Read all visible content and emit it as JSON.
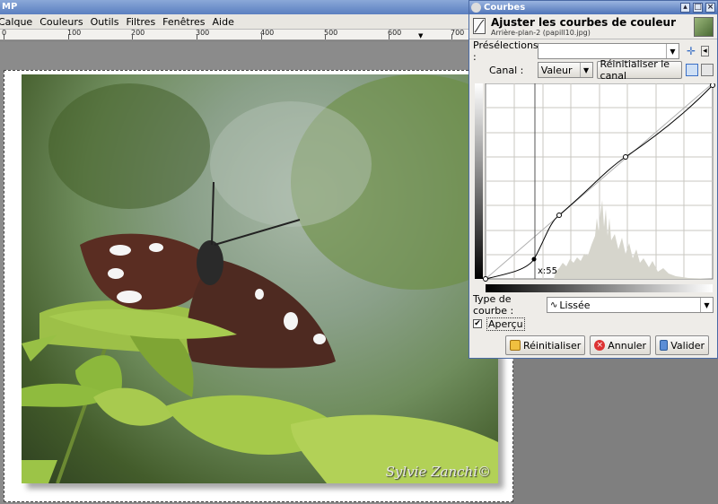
{
  "gimp": {
    "title": "MP",
    "menu": [
      "Calque",
      "Couleurs",
      "Outils",
      "Filtres",
      "Fenêtres",
      "Aide"
    ],
    "ruler_labels": [
      "0",
      "100",
      "200",
      "300",
      "400",
      "500",
      "600",
      "700"
    ],
    "signature": "Sylvie Zanchi©"
  },
  "dialog": {
    "title": "Courbes",
    "heading": "Ajuster les courbes de couleur",
    "subheading": "Arrière-plan-2 (papill10.jpg)",
    "presets_label": "Présélections :",
    "presets_value": "",
    "channel_label": "Canal :",
    "channel_value": "Valeur",
    "reset_channel": "Réinitialiser le canal",
    "x_readout": "x:55",
    "curve_type_label": "Type de courbe :",
    "curve_type_value": "Lissée",
    "preview_label": "Aperçu",
    "preview_checked": true,
    "buttons": {
      "reset": "Réinitialiser",
      "cancel": "Annuler",
      "ok": "Valider"
    }
  }
}
